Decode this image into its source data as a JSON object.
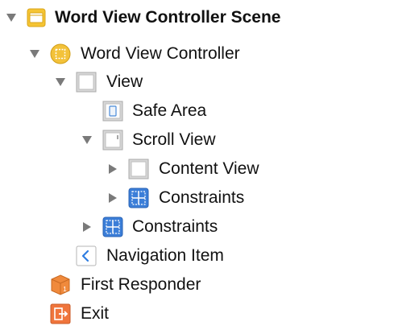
{
  "outline": {
    "scene": {
      "label": "Word View Controller Scene",
      "icon": "storyboard-scene-icon"
    },
    "controller": {
      "label": "Word View Controller",
      "icon": "view-controller-icon"
    },
    "view": {
      "label": "View",
      "icon": "view-icon"
    },
    "safe_area": {
      "label": "Safe Area",
      "icon": "safe-area-icon"
    },
    "scroll_view": {
      "label": "Scroll View",
      "icon": "scroll-view-icon"
    },
    "content_view": {
      "label": "Content View",
      "icon": "view-icon"
    },
    "scroll_constraints": {
      "label": "Constraints",
      "icon": "constraints-icon"
    },
    "view_constraints": {
      "label": "Constraints",
      "icon": "constraints-icon"
    },
    "navigation_item": {
      "label": "Navigation Item",
      "icon": "navigation-item-icon"
    },
    "first_responder": {
      "label": "First Responder",
      "icon": "first-responder-icon"
    },
    "exit": {
      "label": "Exit",
      "icon": "exit-icon"
    }
  },
  "colors": {
    "disclosure": "#7a7a7a",
    "scene_icon": "#f5c433",
    "controller_icon": "#f3c23a",
    "constraints_icon": "#3b7ed8",
    "first_responder": "#f08a3c",
    "exit": "#f0753c",
    "navigation_chevron": "#2f7de1"
  }
}
